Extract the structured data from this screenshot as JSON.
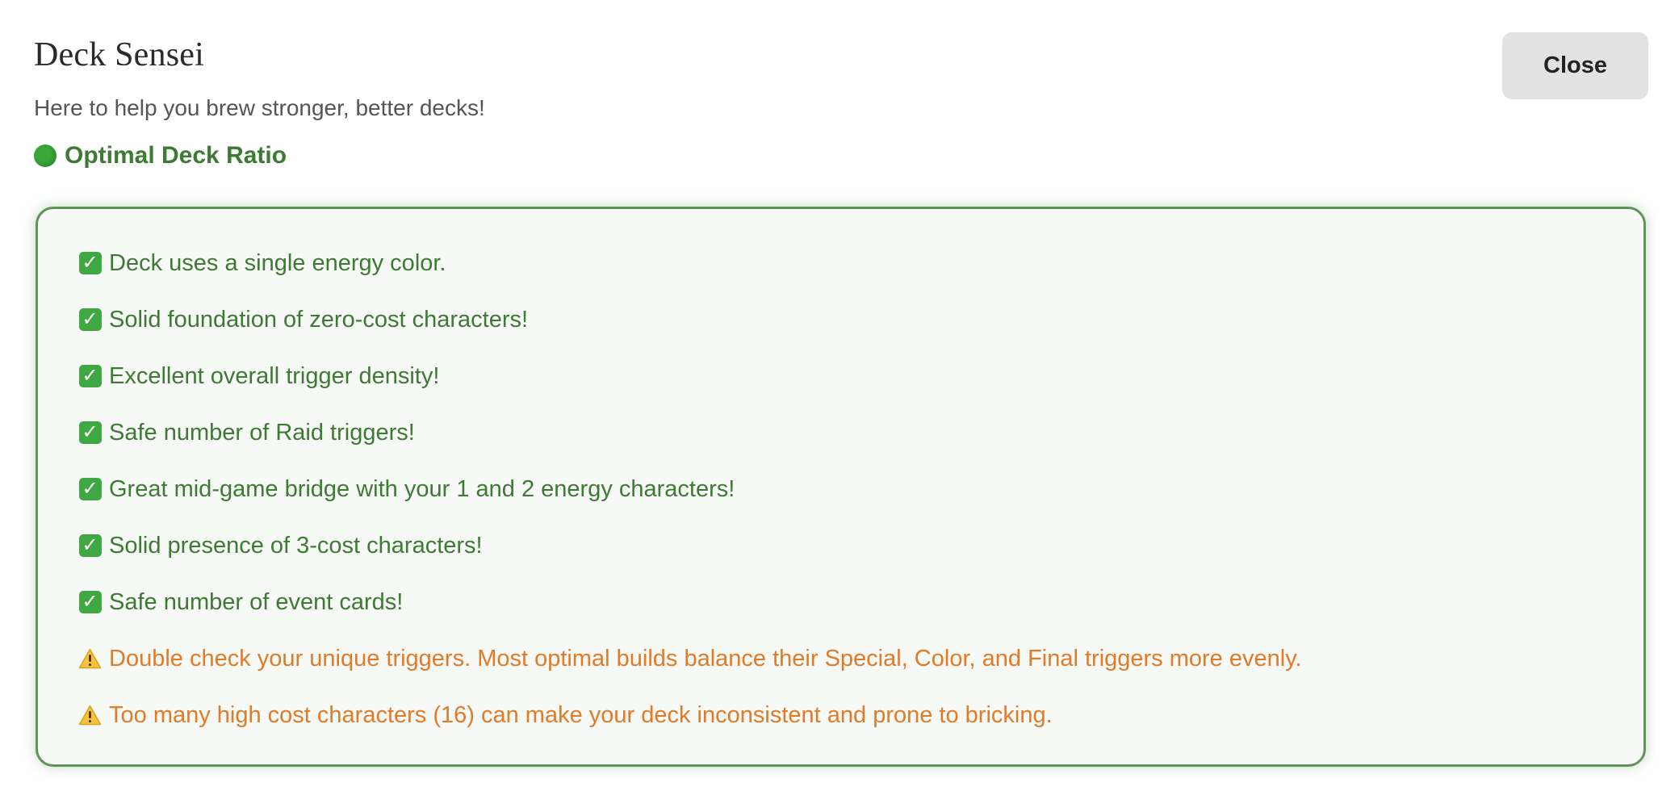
{
  "header": {
    "title": "Deck Sensei",
    "subtitle": "Here to help you brew stronger, better decks!",
    "close_label": "Close"
  },
  "status": {
    "icon": "green-circle-icon",
    "label": "Optimal Deck Ratio",
    "color": "#3d7a33",
    "dot_color": "#3aa63a"
  },
  "colors": {
    "ok_text": "#3d7a33",
    "warn_text": "#e07b28",
    "panel_border": "#5f9458",
    "panel_bg": "#f6f9f5"
  },
  "checks": [
    {
      "type": "ok",
      "icon": "check-mark-icon",
      "text": "Deck uses a single energy color."
    },
    {
      "type": "ok",
      "icon": "check-mark-icon",
      "text": "Solid foundation of zero-cost characters!"
    },
    {
      "type": "ok",
      "icon": "check-mark-icon",
      "text": "Excellent overall trigger density!"
    },
    {
      "type": "ok",
      "icon": "check-mark-icon",
      "text": "Safe number of Raid triggers!"
    },
    {
      "type": "ok",
      "icon": "check-mark-icon",
      "text": "Great mid-game bridge with your 1 and 2 energy characters!"
    },
    {
      "type": "ok",
      "icon": "check-mark-icon",
      "text": "Solid presence of 3-cost characters!"
    },
    {
      "type": "ok",
      "icon": "check-mark-icon",
      "text": "Safe number of event cards!"
    },
    {
      "type": "warn",
      "icon": "warning-icon",
      "text": "Double check your unique triggers. Most optimal builds balance their Special, Color, and Final triggers more evenly."
    },
    {
      "type": "warn",
      "icon": "warning-icon",
      "text": "Too many high cost characters (16) can make your deck inconsistent and prone to bricking."
    }
  ]
}
